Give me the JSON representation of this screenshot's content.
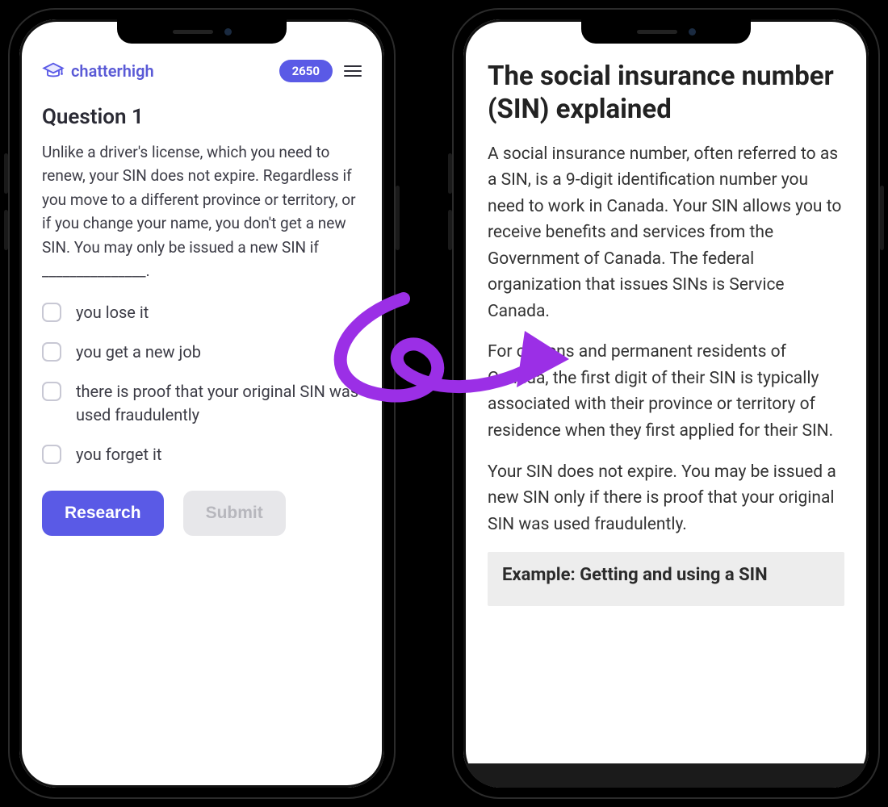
{
  "brand": {
    "name": "chatterhigh"
  },
  "points": "2650",
  "question": {
    "title": "Question 1",
    "body": "Unlike a driver's license, which you need to renew, your SIN does not expire. Regardless if you move to a different province or territory, or if you change your name, you don't get a new SIN. You may only be issued a new SIN if _______________.",
    "options": [
      "you lose it",
      "you get a new job",
      "there is proof that your original SIN was used fraudulently",
      "you forget it"
    ],
    "research_label": "Research",
    "submit_label": "Submit"
  },
  "article": {
    "title": "The social insurance number (SIN) explained",
    "p1": "A social insurance number, often referred to as a SIN, is a 9-digit identification number you need to work in Canada. Your SIN allows you to receive benefits and services from the Government of Canada. The federal organization that issues SINs is Service Canada.",
    "p2": "For citizens and permanent residents of Canada, the first digit of their SIN is typically associated with their province or territory of residence when they first applied for their SIN.",
    "p3": "Your SIN does not expire. You may be issued a new SIN only if there is proof that your original SIN was used fraudulently.",
    "example_heading": "Example: Getting and using a SIN"
  }
}
